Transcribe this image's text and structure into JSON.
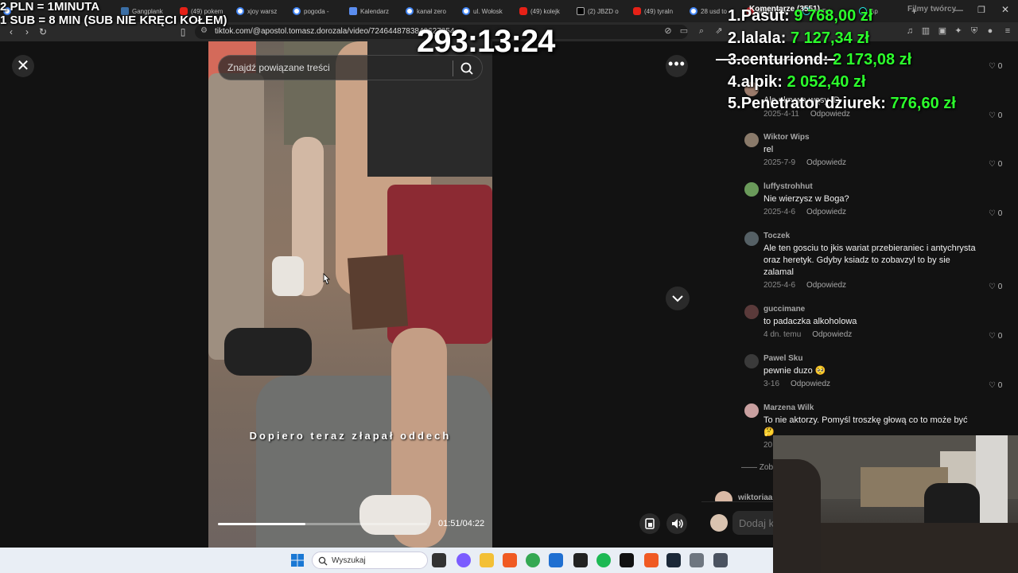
{
  "browser": {
    "tabs": [
      {
        "title": "",
        "icon": "browser-app-icon"
      },
      {
        "title": "Gangplank",
        "icon": "gangplank-favicon"
      },
      {
        "title": "(49) pokem",
        "icon": "youtube-favicon"
      },
      {
        "title": "xjoy warsz",
        "icon": "google-favicon"
      },
      {
        "title": "pogoda - ",
        "icon": "google-favicon"
      },
      {
        "title": "Kalendarz",
        "icon": "calendar-favicon"
      },
      {
        "title": "kanał zero",
        "icon": "google-favicon"
      },
      {
        "title": "ul. Wołosk",
        "icon": "google-favicon"
      },
      {
        "title": "(49) kolejk",
        "icon": "youtube-favicon"
      },
      {
        "title": "(2) JBZD o",
        "icon": "x-favicon"
      },
      {
        "title": "(49) tyraln",
        "icon": "youtube-favicon"
      },
      {
        "title": "28 usd to",
        "icon": "google-favicon"
      },
      {
        "title": "Mega Cha",
        "icon": "mega-favicon"
      },
      {
        "title": "TikTok",
        "icon": "tiktok-favicon"
      },
      {
        "title": "Ap",
        "icon": "tiktok-favicon"
      }
    ],
    "new_tab": "+",
    "url": "tiktok.com/@apostol.tomasz.dorozala/video/7246448783842627354"
  },
  "overlay": {
    "rates_line1": "2 PLN = 1MINUTA",
    "rates_line2": "1 SUB = 8 MIN (SUB NIE KRĘCI KOŁEM)",
    "timer": "293:13:24",
    "leaderboard": [
      {
        "rank": "1.",
        "name": "Pasut:",
        "amount": "9 768,00 zł"
      },
      {
        "rank": "2.",
        "name": "lalala:",
        "amount": "7 127,34 zł"
      },
      {
        "rank": "3.",
        "name": "centuriond:",
        "amount": "2 173,08 zł"
      },
      {
        "rank": "4.",
        "name": "alpik:",
        "amount": "2 052,40 zł"
      },
      {
        "rank": "5.",
        "name": "Penetrator dziurek:",
        "amount": "776,60 zł"
      }
    ]
  },
  "video": {
    "search_placeholder": "Znajdź powiązane treści",
    "subtitle": "Dopiero teraz złapał oddech",
    "time": "01:51/04:22",
    "progress": 0.42
  },
  "panel": {
    "tab_comments": "Komentarze (3551)",
    "tab_creator": "Filmy twórcy",
    "partial_top": [
      {
        "text": "Ale ukrywa wąsy :D",
        "meta": "2025-4-11",
        "reply": "Odpowiedz",
        "likes": "0"
      }
    ],
    "first_like": "0",
    "comments": [
      {
        "user": "Wiktor Wips",
        "text": "rel",
        "meta": "2025-7-9",
        "reply": "Odpowiedz",
        "likes": "0",
        "avatar": "#8a7a6a"
      },
      {
        "user": "luffystrohhut",
        "text": "Nie wierzysz w Boga?",
        "meta": "2025-4-6",
        "reply": "Odpowiedz",
        "likes": "0",
        "avatar": "#6a9a5a"
      },
      {
        "user": "Toczek",
        "text": "Ale ten gosciu to jkis wariat przebieraniec i antychrysta oraz heretyk. Gdyby ksiadz to zobavzyl to by sie zalamal",
        "meta": "2025-4-6",
        "reply": "Odpowiedz",
        "likes": "0",
        "avatar": "#556065"
      },
      {
        "user": "guccimane",
        "text": "to padaczka alkoholowa",
        "meta": "4 dn. temu",
        "reply": "Odpowiedz",
        "likes": "0",
        "avatar": "#5a3a3a"
      },
      {
        "user": "Pawel Sku",
        "text": "pewnie duzo 🥺",
        "meta": "3-16",
        "reply": "Odpowiedz",
        "likes": "0",
        "avatar": "#3a3a3a"
      },
      {
        "user": "Marzena Wilk",
        "text": "To nie aktorzy. Pomyśl troszkę głową co to może być 🤔",
        "meta": "20",
        "reply": "",
        "likes": "",
        "avatar": "#c9a0a0"
      }
    ],
    "view_more": "—— Zob",
    "next_user": "wiktoriaa.",
    "input_placeholder": "Dodaj k"
  },
  "taskbar": {
    "search_label": "Wyszukaj",
    "apps": [
      "task-view-icon",
      "copilot-icon",
      "file-explorer-icon",
      "brave-icon",
      "chrome-icon",
      "store-icon",
      "app-icon",
      "spotify-icon",
      "muza-icon",
      "brave-icon",
      "steam-icon",
      "settings-icon",
      "calculator-icon"
    ]
  },
  "colors": {
    "leaderboard_amount": "#2cff2c",
    "page_bg": "#121212"
  }
}
